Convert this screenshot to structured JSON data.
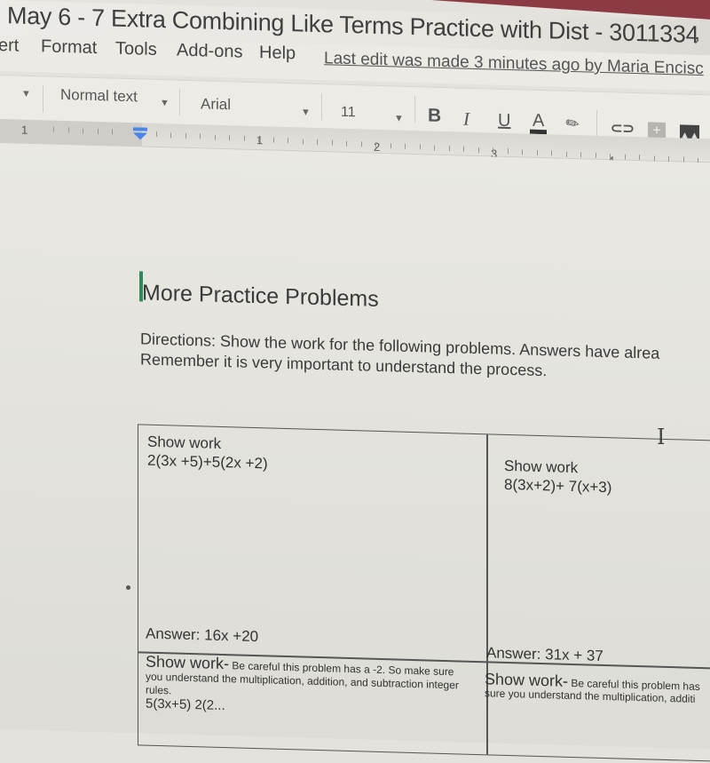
{
  "window": {
    "doc_title": "May 6 - 7  Extra Combining Like Terms Practice with Dist - 3011334"
  },
  "menu": {
    "items": [
      "ert",
      "Format",
      "Tools",
      "Add-ons",
      "Help"
    ],
    "last_edit": "Last edit was made 3 minutes ago by Maria Encisc"
  },
  "toolbar": {
    "style_value": "Normal text",
    "font_value": "Arial",
    "font_size_value": "11",
    "bold_label": "B",
    "italic_label": "I",
    "underline_label": "U",
    "text_color_label": "A",
    "text_color": "#333333",
    "icons": [
      "bold-icon",
      "italic-icon",
      "underline-icon",
      "text-color-icon",
      "highlight-icon",
      "link-icon",
      "comment-icon",
      "image-icon"
    ]
  },
  "ruler": {
    "left_number": "1",
    "numbers": [
      "1",
      "2",
      "3",
      "4"
    ]
  },
  "document": {
    "heading": "More Practice Problems",
    "directions_line1": "Directions:  Show the work for the following problems.  Answers have alrea",
    "directions_line2": "Remember it is very important to understand the process.",
    "table": {
      "cells": [
        {
          "label": "Show work",
          "problem": "2(3x +5)+5(2x +2)",
          "answer": "Answer:  16x +20"
        },
        {
          "label": "Show work",
          "problem": "8(3x+2)+ 7(x+3)",
          "answer": "Answer:  31x + 37"
        },
        {
          "label": "Show work-",
          "note": " Be careful this problem has a -2.  So make sure you understand the multiplication, addition, and subtraction integer rules.",
          "problem": "5(3x+5) 2(2..."
        },
        {
          "label": "Show work-",
          "note": " Be careful this problem has",
          "note_line2": "sure you understand the multiplication, additi"
        }
      ]
    }
  },
  "colors": {
    "cursor_green": "#2e8a5a",
    "indent_blue": "#4a86e8"
  }
}
